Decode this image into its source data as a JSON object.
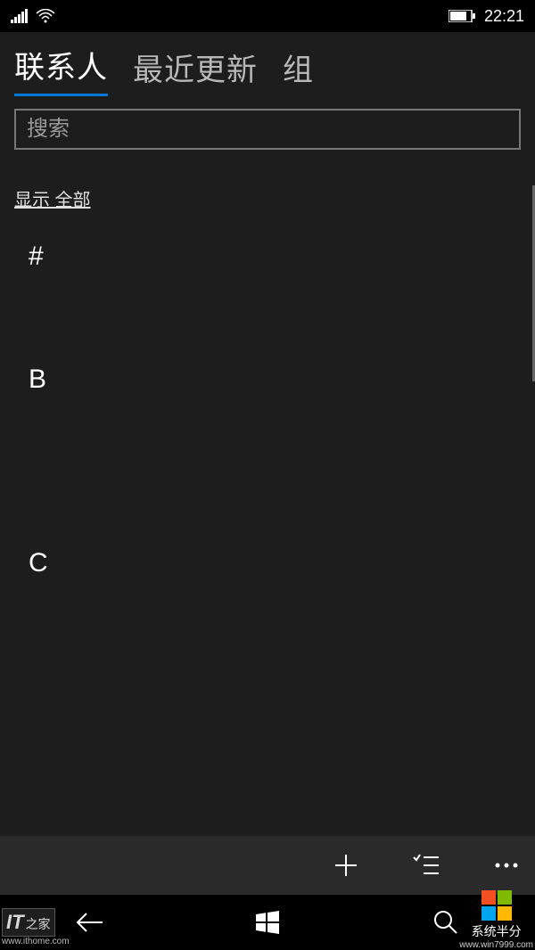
{
  "statusbar": {
    "time": "22:21"
  },
  "tabs": {
    "contacts": "联系人",
    "recent": "最近更新",
    "groups": "组"
  },
  "search": {
    "placeholder": "搜索"
  },
  "filter": {
    "label": "显示 全部"
  },
  "sections": [
    {
      "letter": "#"
    },
    {
      "letter": "B"
    },
    {
      "letter": "C"
    }
  ],
  "watermark_left": {
    "brand_main": "IT",
    "brand_suffix": "之家",
    "url": "www.ithome.com"
  },
  "watermark_right": {
    "text": "系统半分",
    "url": "www.win7999.com"
  }
}
